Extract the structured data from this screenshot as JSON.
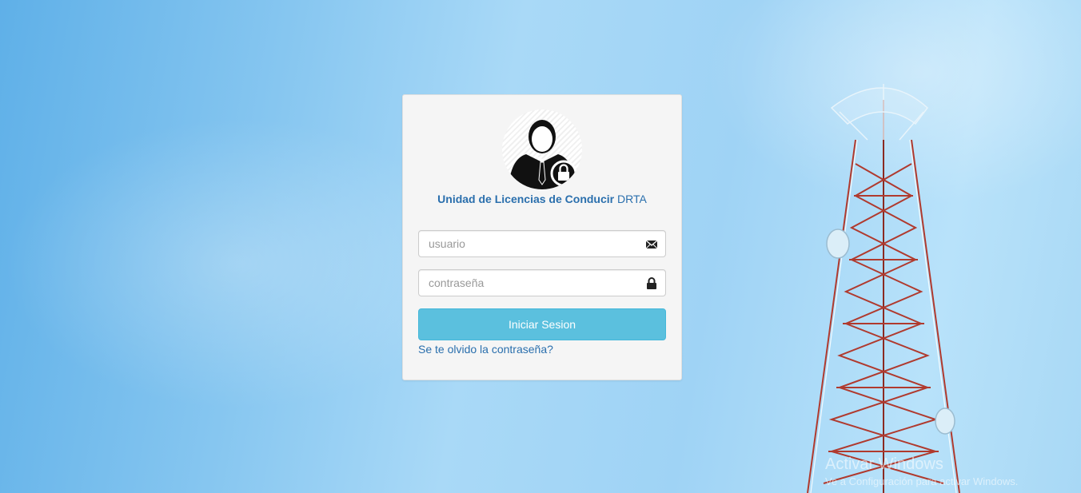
{
  "login": {
    "brand_bold": "Unidad de Licencias de Conducir",
    "brand_suffix": "DRTA",
    "username": {
      "placeholder": "usuario",
      "value": "",
      "icon": "envelope-icon"
    },
    "password": {
      "placeholder": "contraseña",
      "value": "",
      "icon": "lock-icon"
    },
    "submit_label": "Iniciar Sesion",
    "forgot_link": "Se te olvido la contraseña?"
  },
  "watermark": {
    "title": "Activar Windows",
    "subtitle": "Ve a Configuración para activar Windows."
  },
  "colors": {
    "brand": "#2a6fad",
    "button": "#5bc0de",
    "card": "#f5f5f5"
  }
}
